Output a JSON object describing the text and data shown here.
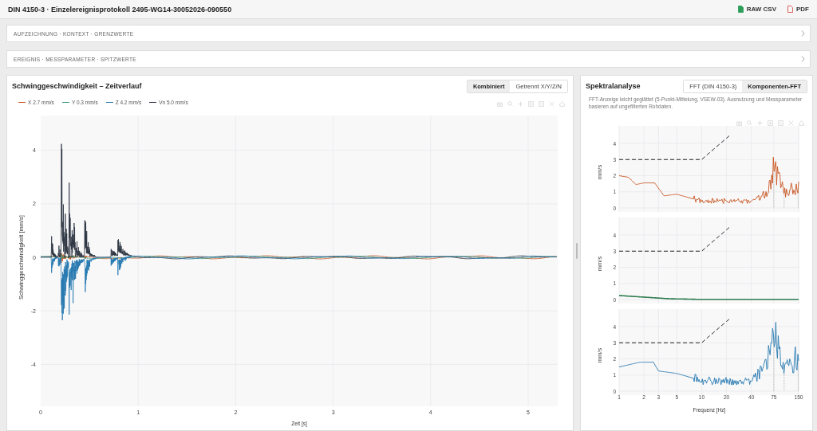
{
  "header": {
    "title": "DIN 4150-3 · Einzelereignisprotokoll 2495-WG14-30052026-090550",
    "exports": [
      {
        "label": "RAW CSV",
        "kind": "csv"
      },
      {
        "label": "PDF",
        "kind": "pdf"
      }
    ]
  },
  "sections": [
    {
      "label": "AUFZEICHNUNG · KONTEXT · GRENZWERTE",
      "expanded": false
    },
    {
      "label": "EREIGNIS · MESSPARAMETER · SPITZWERTE",
      "expanded": false
    }
  ],
  "time_panel": {
    "title": "Schwinggeschwindigkeit – Zeitverlauf",
    "tabs": [
      {
        "label": "Kombiniert",
        "selected": true
      },
      {
        "label": "Getrennt X/Y/Z/N",
        "selected": false
      }
    ],
    "legend": [
      {
        "label": "X 2.7 mm/s",
        "color": "#c8541e"
      },
      {
        "label": "Y 0.3 mm/s",
        "color": "#3a9a7a"
      },
      {
        "label": "Z 4.2 mm/s",
        "color": "#2678b0"
      },
      {
        "label": "Vn 5.0 mm/s",
        "color": "#2b3340"
      }
    ],
    "y_ticks": [
      "4",
      "2",
      "0",
      "-2",
      "-4"
    ],
    "x_ticks": [
      "0",
      "1",
      "2",
      "3",
      "4",
      "5"
    ],
    "ylabel": "Schwinggeschwindigkeit [mm/s]",
    "xlabel": "Zeit [s]"
  },
  "spectrum_panel": {
    "title": "Spektralanalyse",
    "tabs": [
      {
        "label": "FFT (DIN 4150-3)",
        "selected": false
      },
      {
        "label": "Komponenten-FFT",
        "selected": true
      }
    ],
    "note": "FFT-Anzeige leicht geglättet (5-Punkt-Mittelung, VSEW-03). Ausnutzung und Messparameter basieren auf ungefilterten Rohdaten.",
    "plots": [
      {
        "ylabel": "mm/s",
        "color": "#c8541e",
        "y_ticks": [
          "4",
          "3",
          "2",
          "1",
          "0"
        ]
      },
      {
        "ylabel": "mm/s",
        "color": "#2e7d4f",
        "y_ticks": [
          "4",
          "3",
          "2",
          "1",
          "0"
        ]
      },
      {
        "ylabel": "mm/s",
        "color": "#2678b0",
        "y_ticks": [
          "4",
          "3",
          "2",
          "1",
          "0"
        ]
      }
    ],
    "x_ticks": [
      "1",
      "2",
      "3",
      "5",
      "10",
      "20",
      "40",
      "75",
      "150"
    ],
    "xlabel": "Frequenz [Hz]"
  }
}
